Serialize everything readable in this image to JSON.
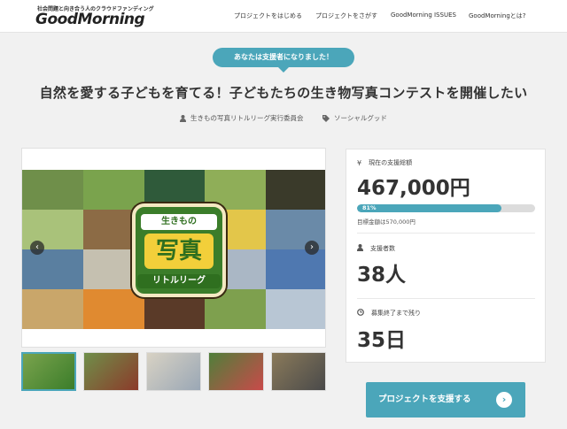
{
  "header": {
    "tagline": "社会問題と向き合う人のクラウドファンディング",
    "logo": "GoodMorning",
    "nav": [
      {
        "label": "プロジェクトをはじめる"
      },
      {
        "label": "プロジェクトをさがす"
      },
      {
        "label": "GoodMorning ISSUES"
      },
      {
        "label": "GoodMorningとは?"
      }
    ]
  },
  "badge": {
    "text": "あなたは支援者になりました！"
  },
  "project": {
    "title": "自然を愛する子どもを育てる！子どもたちの生き物写真コンテストを開催したい",
    "owner": "生きもの写真リトルリーグ実行委員会",
    "category": "ソーシャルグッド",
    "owner_icon": "user-icon",
    "category_icon": "tag-icon"
  },
  "slider": {
    "emblem_top": "生きもの",
    "emblem_mid": "写真",
    "emblem_bot": "リトルリーグ",
    "prev_icon": "chevron-left-icon",
    "next_icon": "chevron-right-icon",
    "prev_glyph": "‹",
    "next_glyph": "›"
  },
  "stats": {
    "funding_label": "現在の支援総額",
    "funding_value": "467,000円",
    "progress_percent": 81,
    "progress_text": "81%",
    "goal_text": "目標金額は570,000円",
    "backers_label": "支援者数",
    "backers_value": "38人",
    "remaining_label": "募集終了まで残り",
    "remaining_value": "35日"
  },
  "cta": {
    "label": "プロジェクトを支援する",
    "icon_glyph": "›"
  },
  "colors": {
    "accent": "#4ba6ba",
    "background": "#f1f1f1"
  }
}
